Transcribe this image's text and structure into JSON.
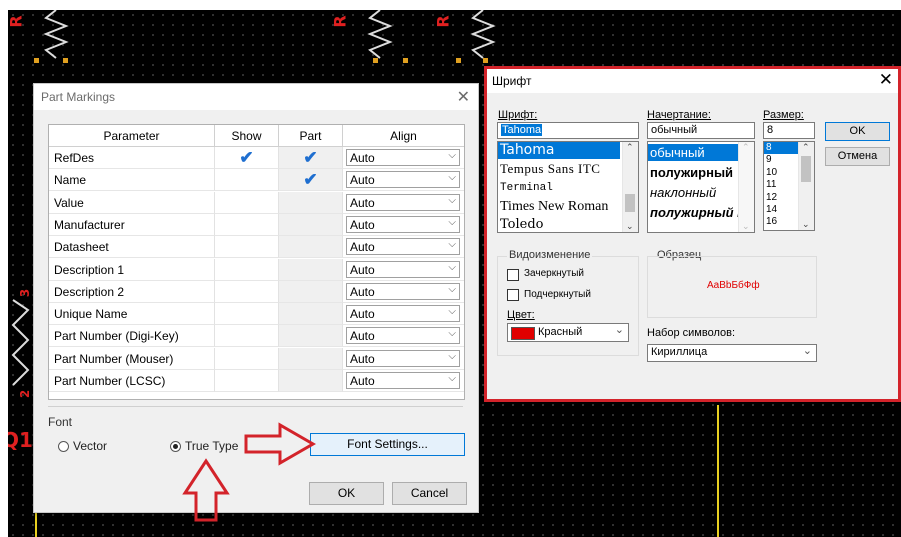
{
  "schematic": {
    "labels": [
      "R",
      "R",
      "R",
      "3",
      "2",
      "Q1"
    ]
  },
  "part_markings": {
    "title": "Part Markings",
    "columns": [
      "Parameter",
      "Show",
      "Part",
      "Align"
    ],
    "rows": [
      {
        "name": "RefDes",
        "show": true,
        "part": true,
        "align": "Auto"
      },
      {
        "name": "Name",
        "show": false,
        "part": true,
        "align": "Auto"
      },
      {
        "name": "Value",
        "show": false,
        "part": false,
        "align": "Auto"
      },
      {
        "name": "Manufacturer",
        "show": false,
        "part": false,
        "align": "Auto"
      },
      {
        "name": "Datasheet",
        "show": false,
        "part": false,
        "align": "Auto"
      },
      {
        "name": "Description 1",
        "show": false,
        "part": false,
        "align": "Auto"
      },
      {
        "name": "Description 2",
        "show": false,
        "part": false,
        "align": "Auto"
      },
      {
        "name": "Unique Name",
        "show": false,
        "part": false,
        "align": "Auto"
      },
      {
        "name": "Part Number (Digi-Key)",
        "show": false,
        "part": false,
        "align": "Auto"
      },
      {
        "name": "Part Number (Mouser)",
        "show": false,
        "part": false,
        "align": "Auto"
      },
      {
        "name": "Part Number (LCSC)",
        "show": false,
        "part": false,
        "align": "Auto"
      }
    ],
    "font_group_label": "Font",
    "font_options": [
      {
        "label": "Vector",
        "selected": false
      },
      {
        "label": "True Type",
        "selected": true
      }
    ],
    "font_settings_button": "Font Settings...",
    "ok_button": "OK",
    "cancel_button": "Cancel",
    "check_glyph": "✔",
    "dropdown_glyph": "⌵"
  },
  "font_dialog": {
    "title": "Шрифт",
    "font_label": "Шрифт:",
    "font_value": "Tahoma",
    "fonts": [
      "Tahoma",
      "Tempus Sans ITC",
      "Terminal",
      "Times New Roman",
      "Toledo"
    ],
    "style_label": "Начертание:",
    "style_value": "обычный",
    "styles": [
      "обычный",
      "полужирный",
      "наклонный",
      "полужирный наклонный"
    ],
    "size_label": "Размер:",
    "size_value": "8",
    "sizes": [
      "8",
      "9",
      "10",
      "11",
      "12",
      "14",
      "16"
    ],
    "ok_button": "OK",
    "cancel_button": "Отмена",
    "effects_label": "Видоизменение",
    "strikeout_label": "Зачеркнутый",
    "underline_label": "Подчеркнутый",
    "color_label": "Цвет:",
    "color_value": "Красный",
    "color_hex": "#e00000",
    "sample_label": "Образец",
    "sample_text": "AaBbБбФф",
    "charset_label": "Набор символов:",
    "charset_value": "Кириллица"
  },
  "colors": {
    "highlight_red": "#d3232a",
    "check_blue": "#1f6fd0",
    "selection_blue": "#0078d7",
    "schematic_red": "#e02020"
  }
}
